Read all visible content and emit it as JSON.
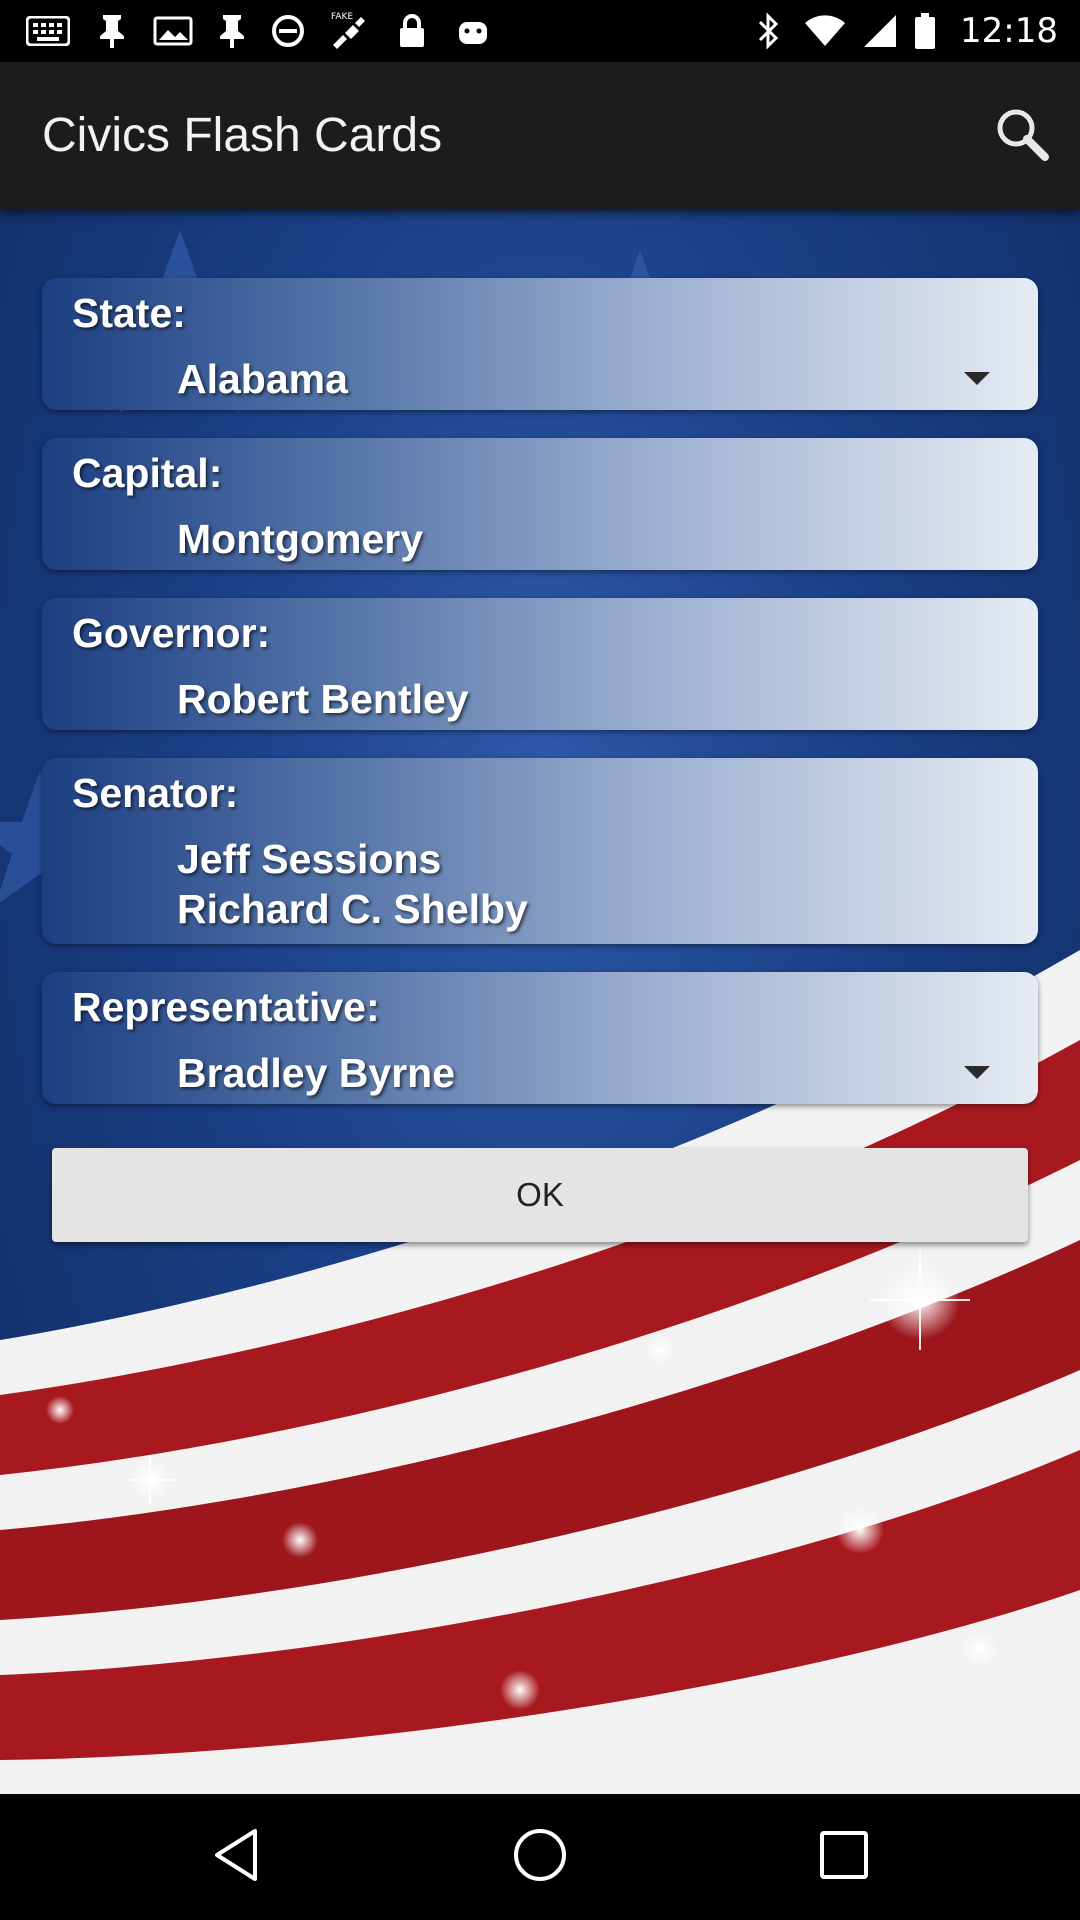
{
  "status_bar": {
    "time": "12:18",
    "icons": [
      "keyboard-icon",
      "pin-icon",
      "image-icon",
      "pin-icon",
      "blocked-icon",
      "fake-gps-icon",
      "lock-icon",
      "android-icon",
      "bluetooth-icon",
      "wifi-icon",
      "signal-icon",
      "battery-icon"
    ]
  },
  "app_bar": {
    "title": "Civics Flash Cards",
    "search_icon": "search-icon"
  },
  "fields": {
    "state": {
      "label": "State:",
      "value": "Alabama"
    },
    "capital": {
      "label": "Capital:",
      "value": "Montgomery"
    },
    "governor": {
      "label": "Governor:",
      "value": "Robert Bentley"
    },
    "senator": {
      "label": "Senator:",
      "values": [
        "Jeff Sessions",
        "Richard C. Shelby"
      ]
    },
    "representative": {
      "label": "Representative:",
      "value": "Bradley Byrne"
    }
  },
  "ok_button": {
    "label": "OK"
  },
  "nav_bar": {
    "icons": [
      "back-icon",
      "home-icon",
      "recents-icon"
    ]
  },
  "colors": {
    "app_bar": "#1c1c1c",
    "background_blue": "#1a3f86",
    "stripe_red": "#a8191f",
    "stripe_white": "#f4f4f4",
    "button": "#e4e4e4"
  }
}
